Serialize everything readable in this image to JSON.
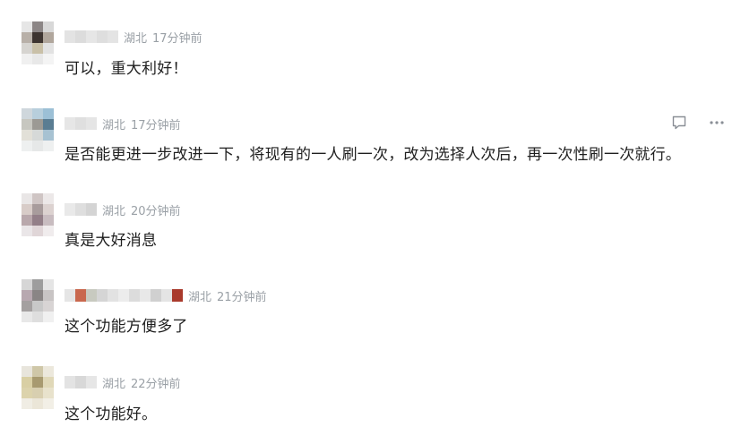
{
  "comments": [
    {
      "location": "湖北",
      "time": "17分钟前",
      "text": "可以，重大利好！",
      "name_blocks": [
        "#e3e3e3",
        "#dcdcdc",
        "#e6e6e6",
        "#dedede",
        "#e4e4e4"
      ],
      "avatar": [
        "#e6e6e6",
        "#8c8686",
        "#d8d8d8",
        "#b8b0a8",
        "#3d3430",
        "#b0a69c",
        "#d6d4d0",
        "#c9c0a8",
        "#e2e2e2",
        "#f0f0f0",
        "#e8e8e8",
        "#f4f4f4"
      ],
      "has_actions": false
    },
    {
      "location": "湖北",
      "time": "17分钟前",
      "text": "是否能更进一步改进一下，将现有的一人刷一次，改为选择人次后，再一次性刷一次就行。",
      "name_blocks": [
        "#e6e6e6",
        "#dfdfdf",
        "#e5e5e5"
      ],
      "avatar": [
        "#cfd7dc",
        "#b8cfdc",
        "#9cc0d6",
        "#c7c7c0",
        "#9c9a94",
        "#5a7d92",
        "#e2e0d8",
        "#d6d9d8",
        "#a7c2d2",
        "#eef0f0",
        "#e6e8e8",
        "#eef0f0"
      ],
      "has_actions": true
    },
    {
      "location": "湖北",
      "time": "20分钟前",
      "text": "真是大好消息",
      "name_blocks": [
        "#e9e9e9",
        "#dedede",
        "#d4d4d4"
      ],
      "avatar": [
        "#e9e6e6",
        "#cfc5c4",
        "#ece8e8",
        "#d8ccc8",
        "#a89c9c",
        "#dcd2d0",
        "#b9a8ac",
        "#937f88",
        "#c8bcc0",
        "#eae6e8",
        "#e0d6d8",
        "#f0eced"
      ],
      "has_actions": false
    },
    {
      "location": "湖北",
      "time": "21分钟前",
      "text": "这个功能方便多了",
      "name_blocks": [
        "#e5e5e5",
        "#c9684e",
        "#c8cac0",
        "#d5d5d5",
        "#e2e2e2",
        "#ececec",
        "#dcdcdc",
        "#e8e8e8",
        "#d0d0d0",
        "#e4e4e4",
        "#a93a2c"
      ],
      "avatar": [
        "#d6d6d6",
        "#9d9d9d",
        "#e5e5e5",
        "#b8a8b0",
        "#8a8585",
        "#c8c4c4",
        "#a4a0a0",
        "#c8c8c8",
        "#d8d4d4",
        "#e8e8e8",
        "#dedede",
        "#f0f0f0"
      ],
      "has_actions": false
    },
    {
      "location": "湖北",
      "time": "22分钟前",
      "text": "这个功能好。",
      "name_blocks": [
        "#e3e3e3",
        "#d8d8d8",
        "#e6e6e6"
      ],
      "avatar": [
        "#e8e5dc",
        "#cfc7a8",
        "#ece8dc",
        "#d9cfa4",
        "#a89a70",
        "#e0d8b8",
        "#dcd3ac",
        "#d8cfb0",
        "#e8e2cc",
        "#f0ede4",
        "#ebe6d8",
        "#f2efe6"
      ],
      "has_actions": false
    }
  ],
  "actions": {
    "reply_icon": "comment-icon",
    "more_icon": "more-icon"
  }
}
